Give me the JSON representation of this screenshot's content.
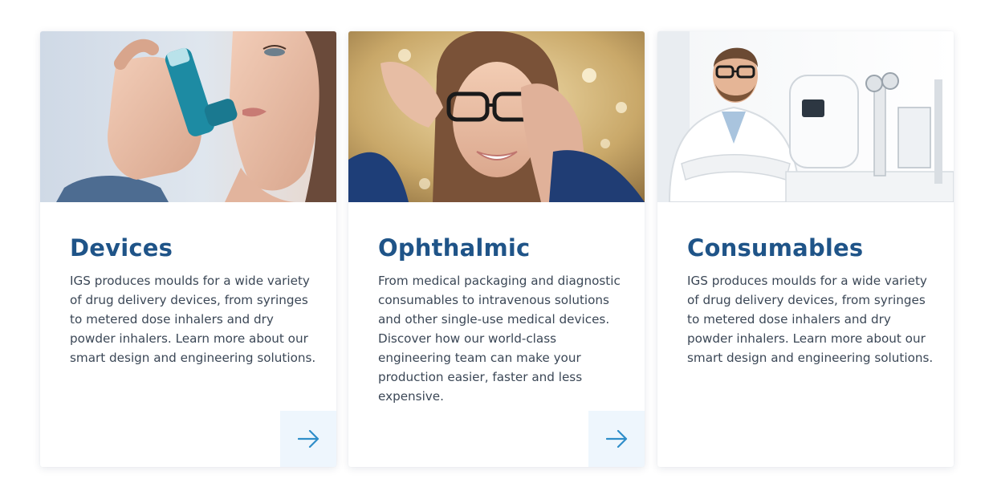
{
  "cards": [
    {
      "title": "Devices",
      "body": "IGS produces moulds for a wide variety of drug delivery devices, from syringes to metered dose inhalers and dry powder inhalers. Learn more about our smart design and engineering solutions.",
      "image_icon": "woman-using-inhaler-photo",
      "has_arrow": true,
      "arrow_icon": "arrow-right-icon"
    },
    {
      "title": "Ophthalmic",
      "body": "From medical packaging and diagnostic consumables to intravenous solutions and other single-use medical devices. Discover how our world-class engineering team can make your production easier, faster and less expensive.",
      "image_icon": "woman-trying-glasses-photo",
      "has_arrow": true,
      "arrow_icon": "arrow-right-icon"
    },
    {
      "title": "Consumables",
      "body": "IGS produces moulds for a wide variety of drug delivery devices, from syringes to metered dose inhalers and dry powder inhalers. Learn more about our smart design and engineering solutions.",
      "image_icon": "optometrist-with-equipment-photo",
      "has_arrow": false
    }
  ],
  "colors": {
    "title": "#1f5488",
    "body_text": "#3b4756",
    "arrow": "#2f8ec9",
    "arrow_button_bg": "#eef6fd",
    "card_bg": "#ffffff"
  }
}
